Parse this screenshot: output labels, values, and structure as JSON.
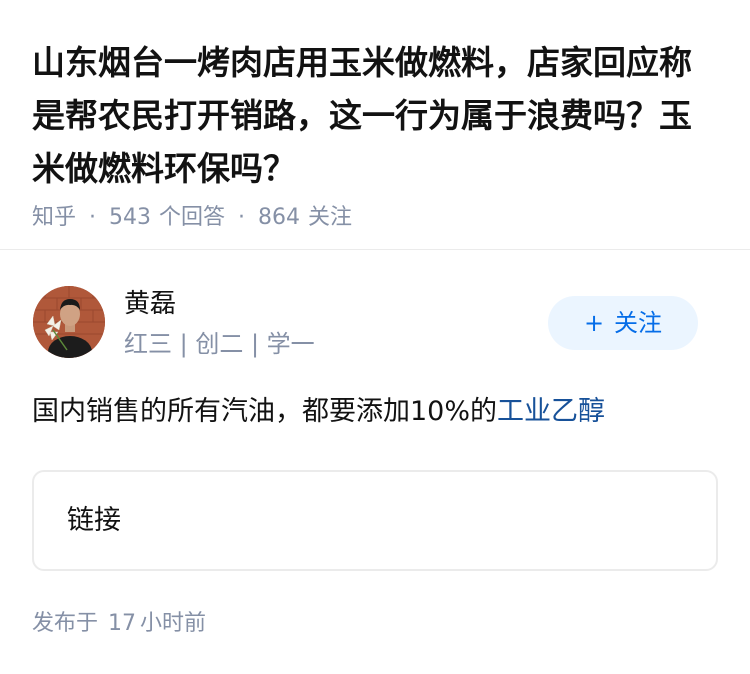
{
  "question": {
    "title": "山东烟台一烤肉店用玉米做燃料，店家回应称是帮农民打开销路，这一行为属于浪费吗？玉米做燃料环保吗？",
    "source": "知乎",
    "separator": "·",
    "answers_count": "543",
    "answers_label": "个回答",
    "followers_count": "864",
    "followers_label": "关注"
  },
  "author": {
    "name": "黄磊",
    "bio": "红三 | 创二 | 学一",
    "avatar_icon": "avatar-photo",
    "follow_plus": "+",
    "follow_label": "关注"
  },
  "answer": {
    "text": "国内销售的所有汽油，都要添加10%的",
    "link_text": "工业乙醇",
    "card_label": "链接"
  },
  "footer": {
    "published_prefix": "发布于",
    "published_number": "17",
    "published_suffix": "小时前"
  },
  "colors": {
    "accent": "#056de8",
    "link": "#175199",
    "meta": "#8590a6",
    "follow_bg": "#ebf5ff"
  }
}
